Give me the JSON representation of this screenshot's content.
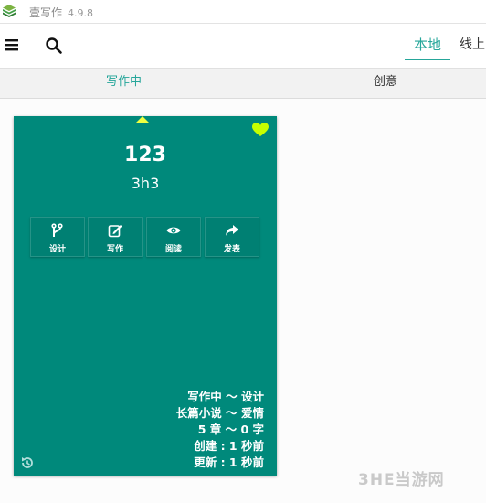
{
  "app": {
    "title": "壹写作",
    "version": "4.9.8"
  },
  "toolbar": {
    "seg_local": "本地",
    "seg_online": "线上"
  },
  "status_tabs": {
    "writing": "写作中",
    "idea": "创意"
  },
  "card": {
    "title": "123",
    "subtitle": "3h3",
    "actions": [
      {
        "label": "设计",
        "icon": "branch-icon"
      },
      {
        "label": "写作",
        "icon": "edit-icon"
      },
      {
        "label": "阅读",
        "icon": "eye-icon"
      },
      {
        "label": "发表",
        "icon": "share-icon"
      }
    ],
    "meta": {
      "status_line": "写作中 ～ 设计",
      "genre_line": "长篇小说 ～ 爱情",
      "count_line": "5 章 ～ 0 字",
      "created_line": "创建 : 1 秒前",
      "updated_line": "更新 : 1 秒前"
    },
    "colors": {
      "background": "#00897b",
      "heart": "#c6ff00",
      "caret": "#eeff41"
    }
  },
  "colors": {
    "accent": "#26a69a"
  },
  "watermark": "3HE当游网"
}
